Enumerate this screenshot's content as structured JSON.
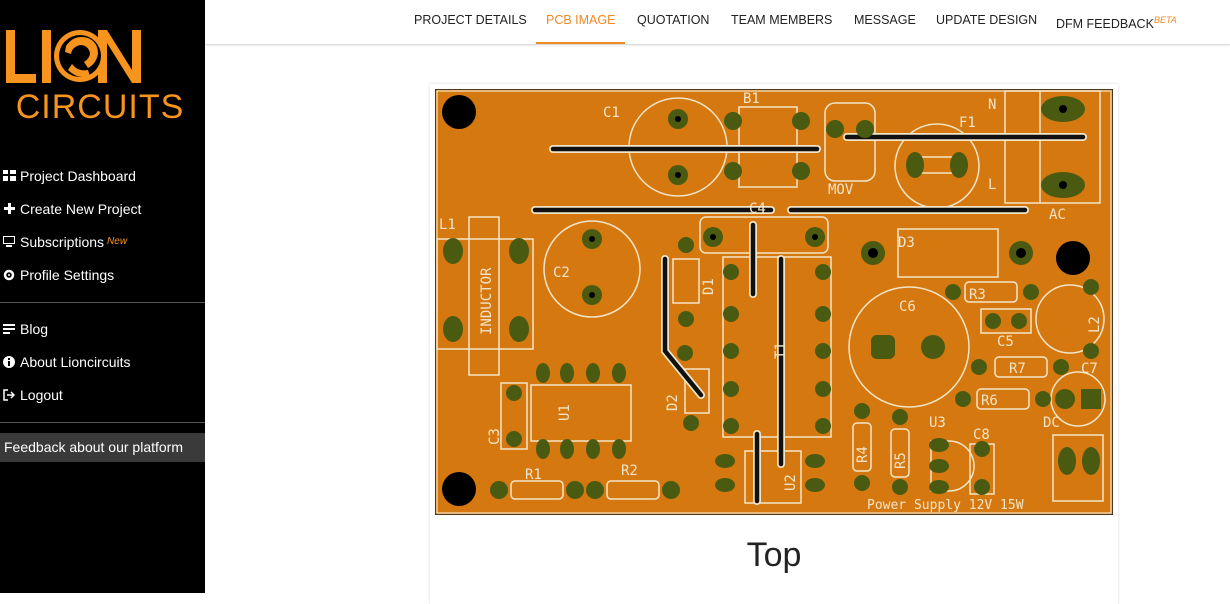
{
  "brand": {
    "line1": "LION",
    "line2": "CIRCUITS",
    "accent": "#f7941d"
  },
  "sidebar": {
    "items": [
      {
        "label": "Project Dashboard",
        "icon": "grid-icon"
      },
      {
        "label": "Create New Project",
        "icon": "plus-icon"
      },
      {
        "label": "Subscriptions",
        "icon": "monitor-icon",
        "badge": "New"
      },
      {
        "label": "Profile Settings",
        "icon": "gear-icon"
      }
    ],
    "items2": [
      {
        "label": "Blog",
        "icon": "list-icon"
      },
      {
        "label": "About Lioncircuits",
        "icon": "info-icon"
      },
      {
        "label": "Logout",
        "icon": "logout-icon"
      }
    ],
    "feedback": "Feedback about our platform"
  },
  "tabs": [
    {
      "label": "PROJECT DETAILS",
      "active": false
    },
    {
      "label": "PCB IMAGE",
      "active": true
    },
    {
      "label": "QUOTATION",
      "active": false
    },
    {
      "label": "TEAM MEMBERS",
      "active": false
    },
    {
      "label": "MESSAGE",
      "active": false
    },
    {
      "label": "UPDATE DESIGN",
      "active": false
    },
    {
      "label": "DFM FEEDBACK",
      "active": false,
      "sup": "BETA"
    }
  ],
  "pcb": {
    "board_color": "#d4780f",
    "labels": {
      "c1": "C1",
      "b1": "B1",
      "f1": "F1",
      "mov": "MOV",
      "ac": "AC",
      "n": "N",
      "l": "L",
      "c4": "C4",
      "l1": "L1",
      "inductor": "INDUCTOR",
      "c2": "C2",
      "d1": "D1",
      "d3": "D3",
      "t1": "T1",
      "c6": "C6",
      "r3": "R3",
      "l2": "L2",
      "c5": "C5",
      "r7": "R7",
      "c7": "C7",
      "r6": "R6",
      "d2": "D2",
      "u1": "U1",
      "c3": "C3",
      "r4": "R4",
      "r5": "R5",
      "u3": "U3",
      "c8": "C8",
      "dc": "DC",
      "u2": "U2",
      "r1": "R1",
      "r2": "R2",
      "footer": "Power Supply 12V 15W"
    }
  },
  "caption": "Top"
}
